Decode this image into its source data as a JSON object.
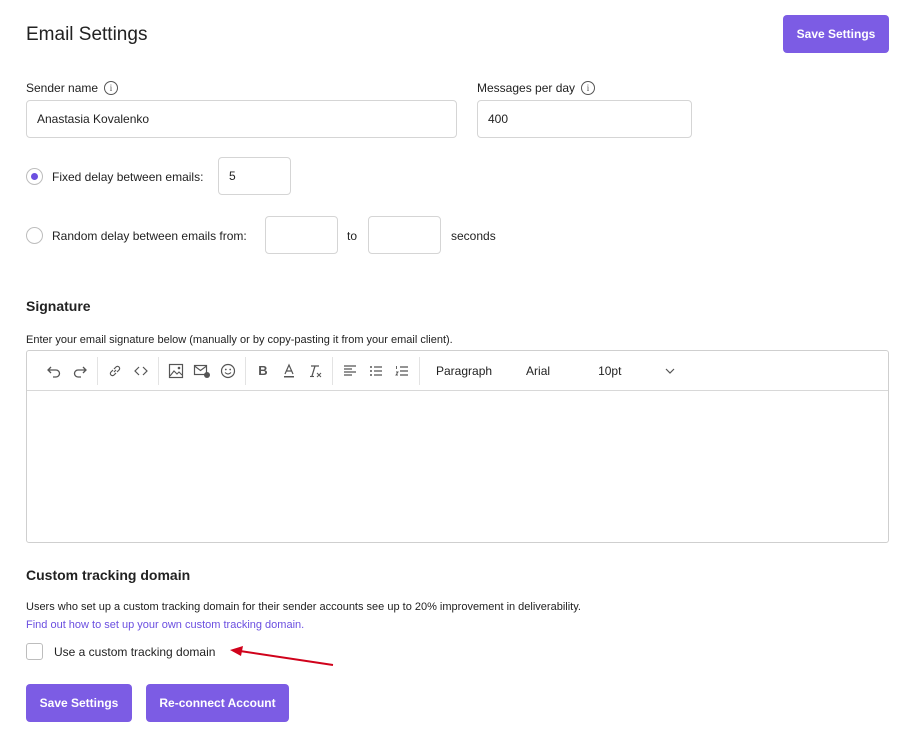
{
  "header": {
    "title": "Email Settings",
    "save_label": "Save Settings"
  },
  "sender": {
    "label": "Sender name",
    "value": "Anastasia Kovalenko"
  },
  "messages": {
    "label": "Messages per day",
    "value": "400"
  },
  "delay": {
    "fixed_label": "Fixed delay between emails:",
    "fixed_value": "5",
    "fixed_selected": true,
    "random_label": "Random delay between emails from:",
    "random_from": "",
    "random_to": "",
    "to_label": "to",
    "unit_label": "seconds"
  },
  "signature": {
    "title": "Signature",
    "description": "Enter your email signature below (manually or by copy-pasting it from your email client).",
    "toolbar": {
      "block_format": "Paragraph",
      "font_family": "Arial",
      "font_size": "10pt"
    },
    "content": ""
  },
  "tracking": {
    "title": "Custom tracking domain",
    "description": "Users who set up a custom tracking domain for their sender accounts see up to 20% improvement in deliverability.",
    "link": "Find out how to set up your own custom tracking domain.",
    "checkbox_label": "Use a custom tracking domain",
    "checked": false
  },
  "footer": {
    "save_label": "Save Settings",
    "reconnect_label": "Re-connect Account"
  },
  "colors": {
    "accent": "#7c5ce4",
    "arrow": "#d0021b"
  }
}
